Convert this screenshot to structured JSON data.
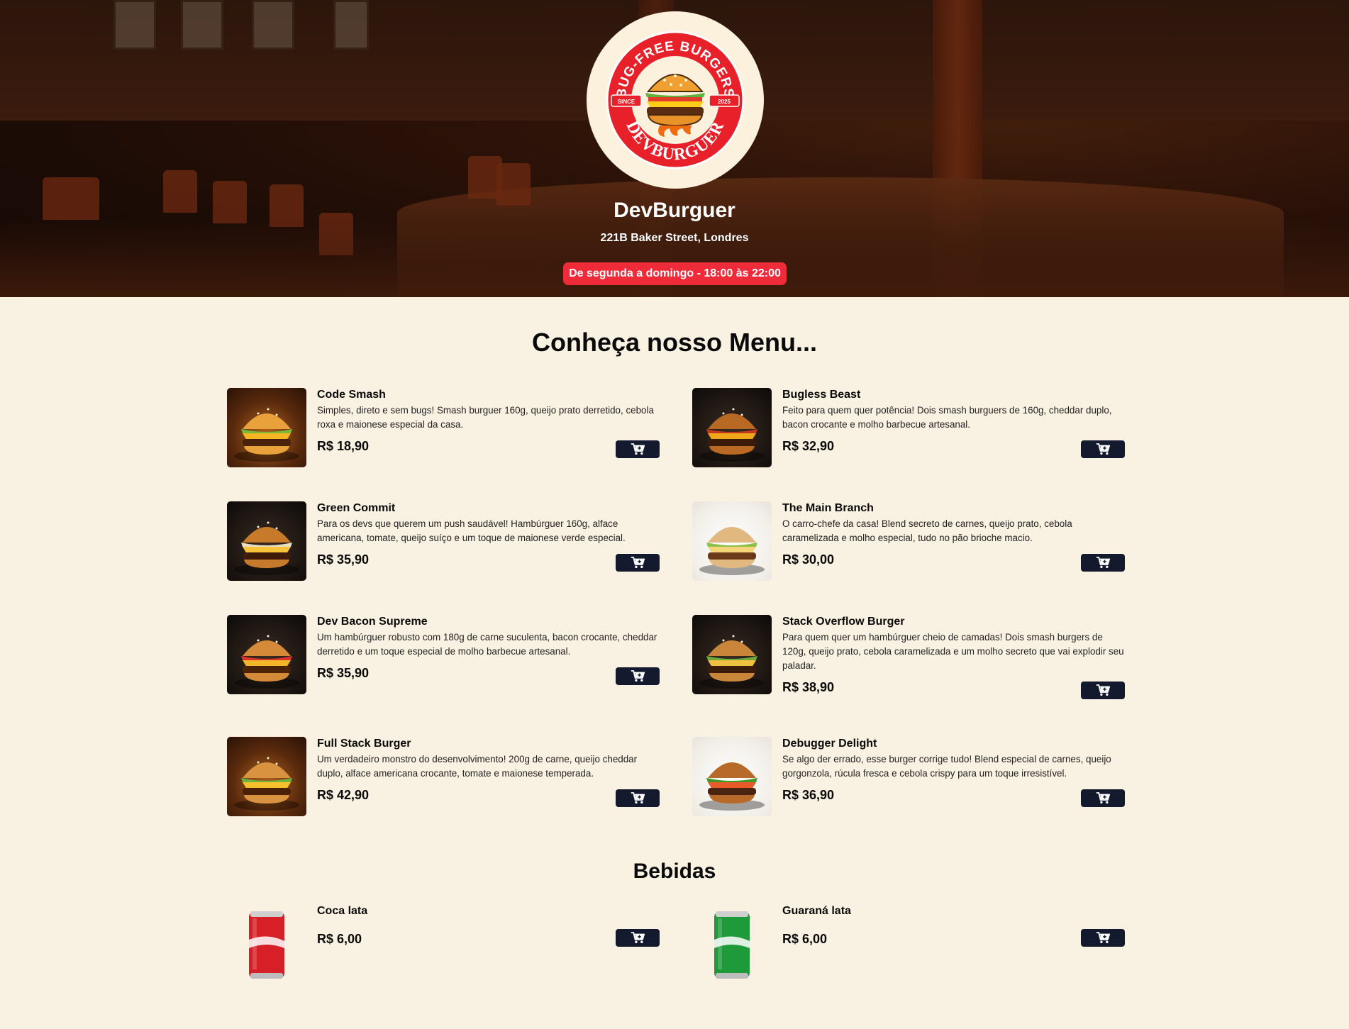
{
  "restaurant": {
    "name": "DevBurguer",
    "address": "221B Baker Street, Londres",
    "hours": "De segunda a domingo - 18:00 às 22:00",
    "logo": {
      "top_text": "BUG-FREE BURGERS",
      "since": "SINCE",
      "year": "2025",
      "bottom_text": "DEVBURGUER"
    }
  },
  "menu": {
    "title": "Conheça nosso Menu...",
    "items": [
      {
        "name": "Code Smash",
        "description": "Simples, direto e sem bugs! Smash burguer 160g, queijo prato derretido, cebola roxa e maionese especial da casa.",
        "price": "R$ 18,90",
        "image": "burger-photo"
      },
      {
        "name": "Bugless Beast",
        "description": "Feito para quem quer potência! Dois smash burguers de 160g, cheddar duplo, bacon crocante e molho barbecue artesanal.",
        "price": "R$ 32,90",
        "image": "burger-photo"
      },
      {
        "name": "Green Commit",
        "description": "Para os devs que querem um push saudável! Hambúrguer 160g, alface americana, tomate, queijo suíço e um toque de maionese verde especial.",
        "price": "R$ 35,90",
        "image": "burger-photo"
      },
      {
        "name": "The Main Branch",
        "description": "O carro-chefe da casa! Blend secreto de carnes, queijo prato, cebola caramelizada e molho especial, tudo no pão brioche macio.",
        "price": "R$ 30,00",
        "image": "burger-photo"
      },
      {
        "name": "Dev Bacon Supreme",
        "description": "Um hambúrguer robusto com 180g de carne suculenta, bacon crocante, cheddar derretido e um toque especial de molho barbecue artesanal.",
        "price": "R$ 35,90",
        "image": "burger-photo"
      },
      {
        "name": "Stack Overflow Burger",
        "description": "Para quem quer um hambúrguer cheio de camadas! Dois smash burgers de 120g, queijo prato, cebola caramelizada e um molho secreto que vai explodir seu paladar.",
        "price": "R$ 38,90",
        "image": "burger-photo"
      },
      {
        "name": "Full Stack Burger",
        "description": "Um verdadeiro monstro do desenvolvimento! 200g de carne, queijo cheddar duplo, alface americana crocante, tomate e maionese temperada.",
        "price": "R$ 42,90",
        "image": "burger-photo"
      },
      {
        "name": "Debugger Delight",
        "description": "Se algo der errado, esse burger corrige tudo! Blend especial de carnes, queijo gorgonzola, rúcula fresca e cebola crispy para um toque irresistível.",
        "price": "R$ 36,90",
        "image": "burger-photo"
      }
    ]
  },
  "drinks": {
    "title": "Bebidas",
    "items": [
      {
        "name": "Coca lata",
        "price": "R$ 6,00",
        "image": "coca-can",
        "color": "#d61f26"
      },
      {
        "name": "Guaraná lata",
        "price": "R$ 6,00",
        "image": "guarana-can",
        "color": "#1f9a3a"
      }
    ]
  },
  "colors": {
    "background": "#f9f1e1",
    "accent_red": "#ef2b3a",
    "cart_button": "#131a2e"
  },
  "icons": {
    "cart": "cart-plus-icon"
  }
}
